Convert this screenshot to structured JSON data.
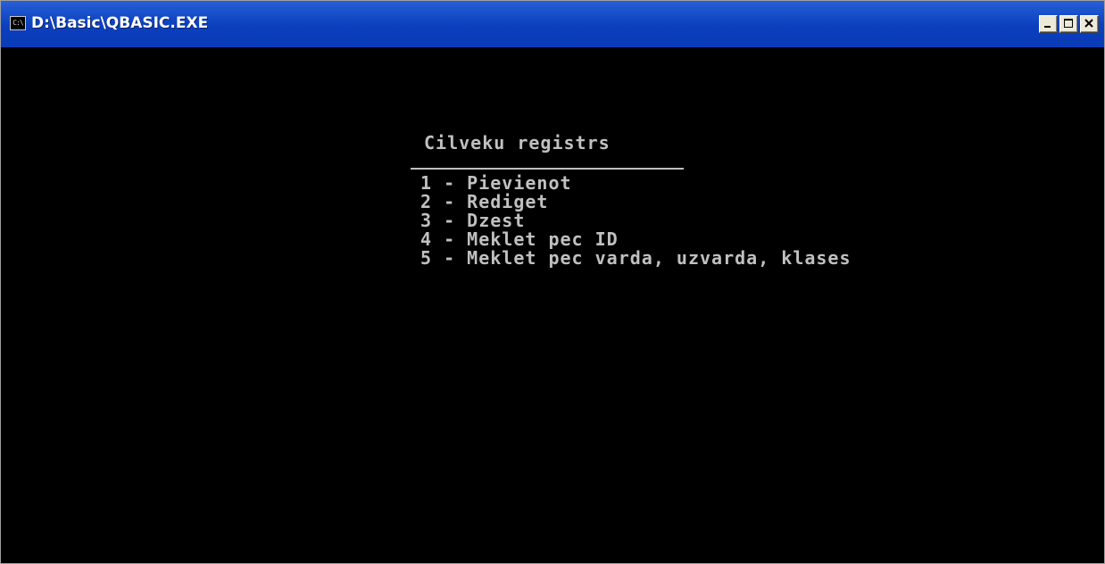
{
  "window": {
    "title": "D:\\Basic\\QBASIC.EXE",
    "icon": "console-icon",
    "icon_text": "C:\\",
    "buttons": {
      "minimize": "minimize-icon",
      "maximize": "maximize-icon",
      "close": "close-icon"
    }
  },
  "console": {
    "menu_title": "Cilveku registrs",
    "items": [
      "1 - Pievienot",
      "2 - Rediget",
      "3 - Dzest",
      "4 - Meklet pec ID",
      "5 - Meklet pec varda, uzvarda, klases"
    ]
  },
  "colors": {
    "titlebar": "#0a3bb6",
    "console_bg": "#000000",
    "console_fg": "#c0c0c0"
  }
}
